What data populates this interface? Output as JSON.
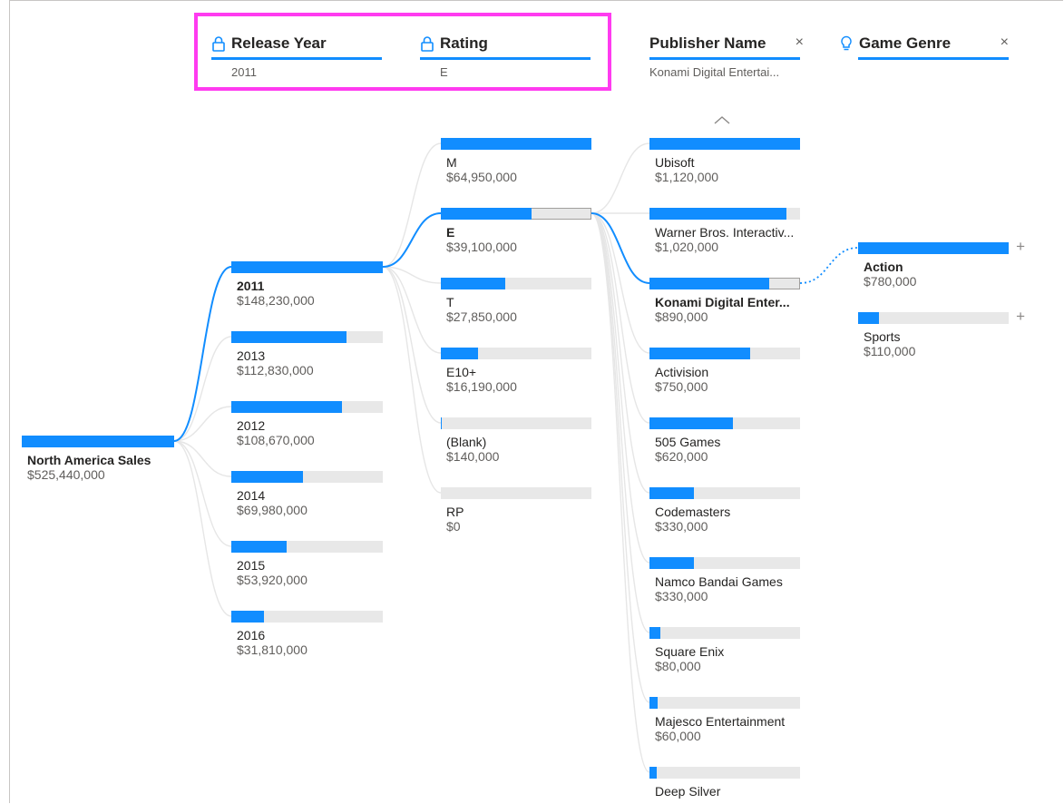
{
  "headers": [
    {
      "title": "Release Year",
      "value": "2011",
      "icon": "lock-icon",
      "locked": true
    },
    {
      "title": "Rating",
      "value": "E",
      "icon": "lock-icon",
      "locked": true
    },
    {
      "title": "Publisher Name",
      "value": "Konami Digital Entertai...",
      "close": "×"
    },
    {
      "title": "Game Genre",
      "value": "",
      "icon": "lightbulb-icon",
      "close": "×"
    }
  ],
  "root": {
    "label": "North America Sales",
    "value": "$525,440,000",
    "fraction": 1.0
  },
  "years": [
    {
      "label": "2011",
      "value": "$148,230,000",
      "fraction": 1.0,
      "selected": true
    },
    {
      "label": "2013",
      "value": "$112,830,000",
      "fraction": 0.761
    },
    {
      "label": "2012",
      "value": "$108,670,000",
      "fraction": 0.733
    },
    {
      "label": "2014",
      "value": "$69,980,000",
      "fraction": 0.472
    },
    {
      "label": "2015",
      "value": "$53,920,000",
      "fraction": 0.364
    },
    {
      "label": "2016",
      "value": "$31,810,000",
      "fraction": 0.215
    }
  ],
  "ratings": [
    {
      "label": "M",
      "value": "$64,950,000",
      "fraction": 1.0
    },
    {
      "label": "E",
      "value": "$39,100,000",
      "fraction": 0.602,
      "selected": true
    },
    {
      "label": "T",
      "value": "$27,850,000",
      "fraction": 0.429
    },
    {
      "label": "E10+",
      "value": "$16,190,000",
      "fraction": 0.249
    },
    {
      "label": "(Blank)",
      "value": "$140,000",
      "fraction": 0.002
    },
    {
      "label": "RP",
      "value": "$0",
      "fraction": 0.0
    }
  ],
  "publishers": [
    {
      "label": "Ubisoft",
      "value": "$1,120,000",
      "fraction": 1.0
    },
    {
      "label": "Warner Bros. Interactiv...",
      "value": "$1,020,000",
      "fraction": 0.911
    },
    {
      "label": "Konami Digital Enter...",
      "value": "$890,000",
      "fraction": 0.795,
      "selected": true
    },
    {
      "label": "Activision",
      "value": "$750,000",
      "fraction": 0.67
    },
    {
      "label": "505 Games",
      "value": "$620,000",
      "fraction": 0.554
    },
    {
      "label": "Codemasters",
      "value": "$330,000",
      "fraction": 0.295
    },
    {
      "label": "Namco Bandai Games",
      "value": "$330,000",
      "fraction": 0.295
    },
    {
      "label": "Square Enix",
      "value": "$80,000",
      "fraction": 0.071
    },
    {
      "label": "Majesco Entertainment",
      "value": "$60,000",
      "fraction": 0.054
    },
    {
      "label": "Deep Silver",
      "value": "",
      "fraction": 0.05
    }
  ],
  "genres": [
    {
      "label": "Action",
      "value": "$780,000",
      "fraction": 1.0,
      "plus": "+"
    },
    {
      "label": "Sports",
      "value": "$110,000",
      "fraction": 0.141,
      "plus": "+"
    }
  ],
  "colors": {
    "accent": "#118dff",
    "track": "#e8e8e8",
    "highlight": "#ff3bf0"
  }
}
